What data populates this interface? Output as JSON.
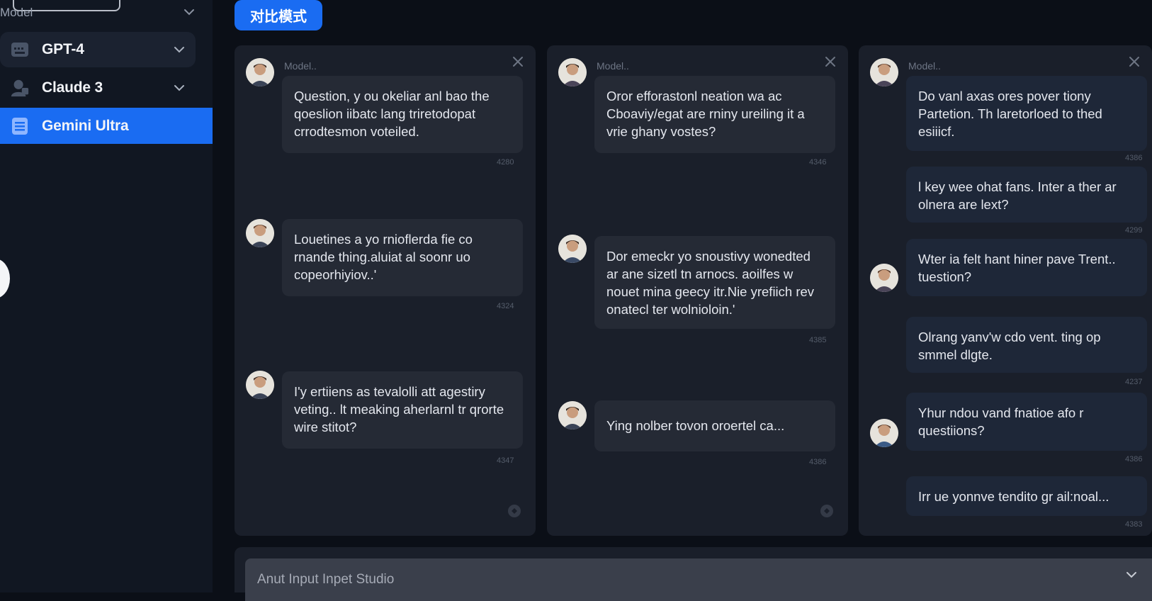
{
  "sidebar": {
    "header_label": "Model",
    "items": [
      {
        "label": "GPT-4",
        "icon": "keyboard-icon"
      },
      {
        "label": "Claude 3",
        "icon": "robot-icon"
      },
      {
        "label": "Gemini Ultra",
        "icon": "document-icon"
      }
    ]
  },
  "toolbar": {
    "compare_label": "对比模式"
  },
  "panels": [
    {
      "title": "Model..",
      "messages": [
        {
          "text": "Question, y ou okeliar anl bao the qoeslion iibatc lang triretodopat crrodtesmon voteiled.",
          "time": "4280"
        },
        {
          "text": "Louetines a yo rnioflerda fie co rnande thing.aluiat al soonr uo copeorhiyiov..'",
          "time": "4324"
        },
        {
          "text": "I'y ertiiens as tevalolli att agestiry veting.. lt meaking aherlarnl tr qrorte wire stitot?",
          "time": "4347"
        }
      ]
    },
    {
      "title": "Model..",
      "messages": [
        {
          "text": "Oror efforastonl neation wa ac Cboaviy/egat are rniny ureiling it a vrie ghany vostes?",
          "time": "4346"
        },
        {
          "text": "Dor emeckr yo snoustivy wonedted ar ane sizetl tn arnocs. aoilfes w nouet mina geecy itr.Nie yrefiich rev onatecl ter wolnioloin.'",
          "time": "4385"
        },
        {
          "text": "Ying nolber tovon oroertel ca...",
          "time": "4386"
        }
      ]
    },
    {
      "title": "Model..",
      "messages": [
        {
          "text": "Do vanl axas ores pover tiony Partetion. Th laretorloed to thed esiiicf.",
          "time": "4386"
        },
        {
          "text": "l key wee ohat fans. Inter a ther ar olnera are lext?",
          "time": "4299"
        },
        {
          "text": "Wter ia felt hant hiner pave Trent.. tuestion?",
          "time": ""
        },
        {
          "text": "Olrang yanv'w cdo vent. ting op smmel dlgte.",
          "time": "4237"
        },
        {
          "text": "Yhur ndou vand fnatioe afo r questiions?",
          "time": "4386"
        },
        {
          "text": "Irr ue yonnve tendito gr ail:noal...",
          "time": "4383"
        }
      ]
    }
  ],
  "input": {
    "placeholder": "Anut Input Inpet Studio"
  },
  "colors": {
    "accent": "#1a6cf2",
    "background": "#0b0f17",
    "panel": "#1a1f2a",
    "bubble": "#252a35"
  }
}
